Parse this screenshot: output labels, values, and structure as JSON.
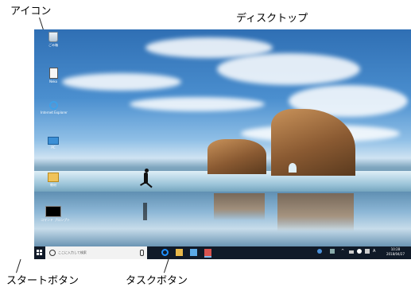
{
  "callouts": {
    "icon": "アイコン",
    "desktop": "ディスクトップ",
    "start_button": "スタートボタン",
    "task_button": "タスクボタン"
  },
  "desktop_icons": [
    {
      "label": "ごみ箱",
      "icon": "recycle-bin-icon"
    },
    {
      "label": "Neko",
      "icon": "user-folder-icon"
    },
    {
      "label": "Internet Explorer",
      "icon": "internet-explorer-icon"
    },
    {
      "label": "PC",
      "icon": "pc-icon"
    },
    {
      "label": "教材",
      "icon": "folder-icon"
    },
    {
      "label": "コマンド プロンプト",
      "icon": "command-prompt-icon"
    }
  ],
  "taskbar": {
    "search_placeholder": "ここに入力して検索",
    "clock_time": "10:28",
    "clock_date": "2018/04/27",
    "ime": "A",
    "colors": {
      "taskbar": "#101a28",
      "edge": "#1e90ff",
      "explorer": "#e8b84a",
      "store": "#5aa9e6",
      "app": "#d9534f"
    }
  }
}
